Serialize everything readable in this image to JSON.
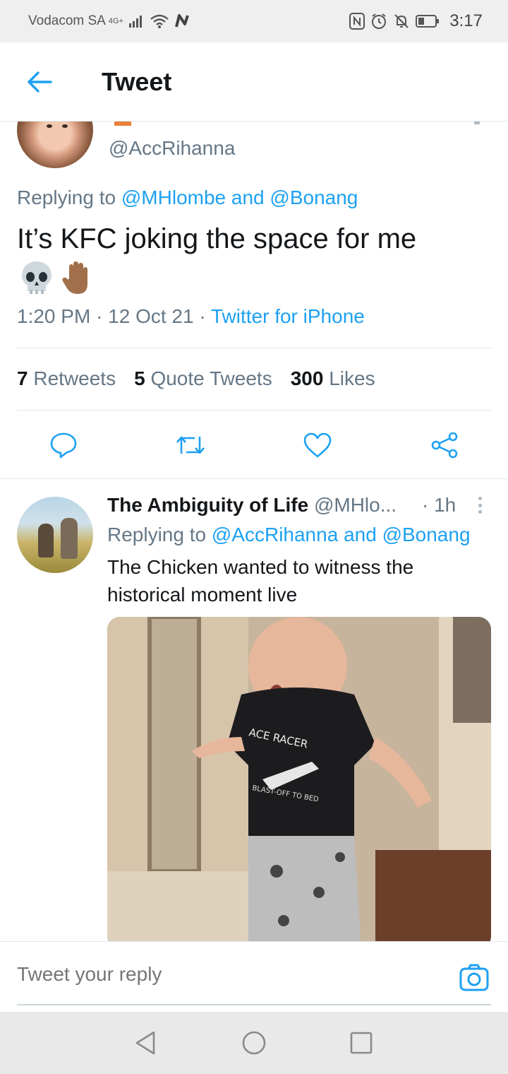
{
  "status_bar": {
    "carrier": "Vodacom SA",
    "network": "4G+",
    "time": "3:17"
  },
  "header": {
    "title": "Tweet"
  },
  "main_tweet": {
    "handle": "@AccRihanna",
    "reply_prefix": "Replying to",
    "reply_user1": "@MHlombe",
    "reply_and": "and",
    "reply_user2": "@Bonang",
    "text": "It’s KFC joking the space for me",
    "emoji": [
      "skull-emoji",
      "raised-hand-emoji"
    ],
    "time": "1:20 PM",
    "date": "12 Oct 21",
    "source": "Twitter for iPhone",
    "retweets_count": "7",
    "retweets_label": "Retweets",
    "quotes_count": "5",
    "quotes_label": "Quote Tweets",
    "likes_count": "300",
    "likes_label": "Likes"
  },
  "reply_tweet": {
    "name": "The Ambiguity of Life",
    "handle": "@MHlo...",
    "time": "· 1h",
    "reply_prefix": "Replying to",
    "reply_user1": "@AccRihanna",
    "reply_and": "and",
    "reply_user2": "@Bonang",
    "text": "The Chicken wanted to witness the historical moment live",
    "media_shirt_text1": "ACE RACER",
    "media_shirt_text2": "BLAST-OFF TO BED"
  },
  "composer": {
    "placeholder": "Tweet your reply"
  },
  "colors": {
    "accent": "#1da1f2",
    "secondary_text": "#657786",
    "divider": "#e1e8ed"
  }
}
